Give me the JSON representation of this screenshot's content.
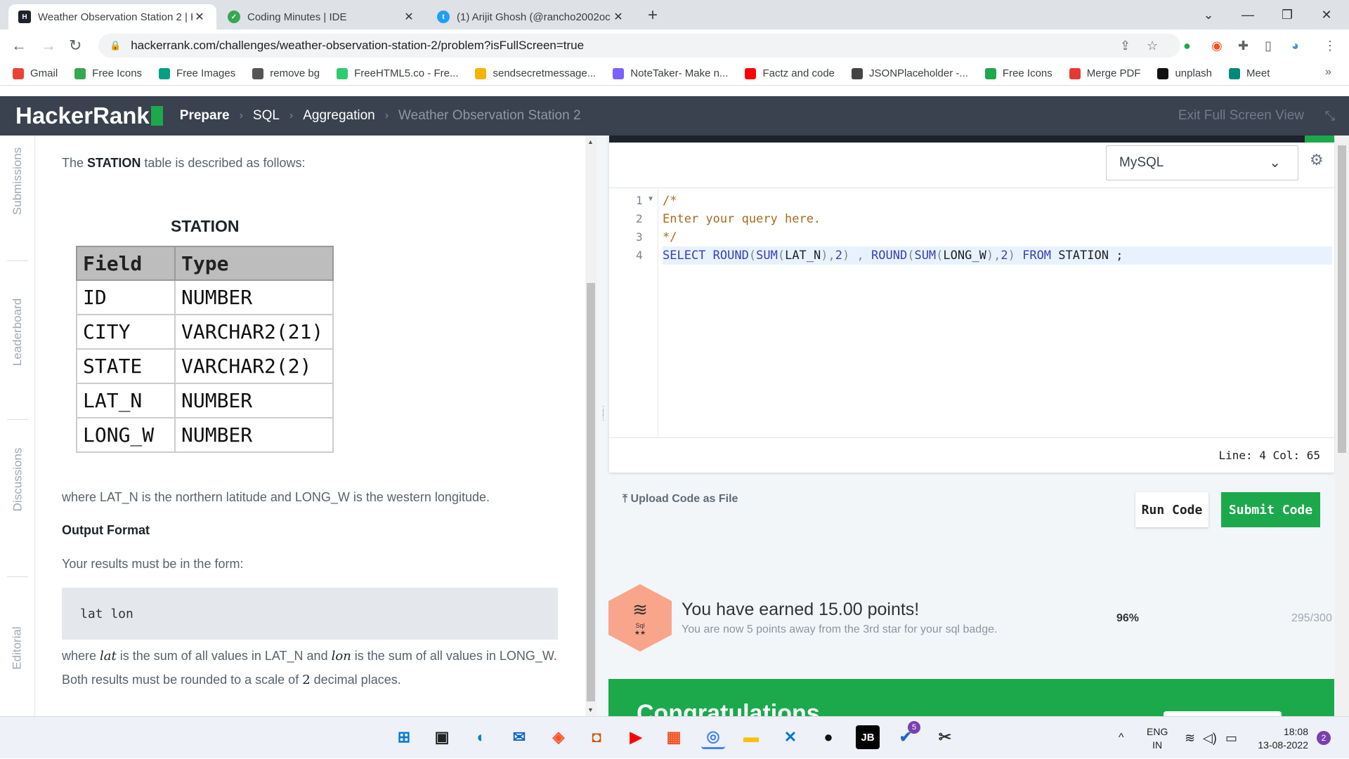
{
  "browser": {
    "tabs": [
      {
        "title": "Weather Observation Station 2 | H",
        "icon": "hackerrank-icon",
        "active": true
      },
      {
        "title": "Coding Minutes | IDE",
        "icon": "check-circle-icon",
        "active": false
      },
      {
        "title": "(1) Arijit Ghosh (@rancho2002oc",
        "icon": "twitter-icon",
        "active": false
      }
    ],
    "url": "hackerrank.com/challenges/weather-observation-station-2/problem?isFullScreen=true",
    "bookmarks": [
      {
        "label": "Gmail",
        "icon": "gmail-icon",
        "color": "#ea4335"
      },
      {
        "label": "Free Icons",
        "icon": "leaf-icon",
        "color": "#34a853"
      },
      {
        "label": "Free Images",
        "icon": "pexels-icon",
        "color": "#05a081"
      },
      {
        "label": "remove bg",
        "icon": "removebg-icon",
        "color": "#555555"
      },
      {
        "label": "FreeHTML5.co - Fre...",
        "icon": "html5-icon",
        "color": "#2ecc71"
      },
      {
        "label": "sendsecretmessage...",
        "icon": "message-icon",
        "color": "#f4b400"
      },
      {
        "label": "NoteTaker- Make n...",
        "icon": "note-icon",
        "color": "#7b61ff"
      },
      {
        "label": "Factz and code",
        "icon": "youtube-icon",
        "color": "#ff0000"
      },
      {
        "label": "JSONPlaceholder -...",
        "icon": "json-icon",
        "color": "#444444"
      },
      {
        "label": "Free Icons",
        "icon": "icons-icon",
        "color": "#1ba94c"
      },
      {
        "label": "Merge PDF",
        "icon": "pdf-icon",
        "color": "#e53935"
      },
      {
        "label": "unplash",
        "icon": "unsplash-icon",
        "color": "#111111"
      },
      {
        "label": "Meet",
        "icon": "meet-icon",
        "color": "#00897b"
      }
    ]
  },
  "header": {
    "logo": "HackerRank",
    "crumbs": [
      "Prepare",
      "SQL",
      "Aggregation",
      "Weather Observation Station 2"
    ],
    "exit_label": "Exit Full Screen View"
  },
  "side_tabs": [
    "Submissions",
    "Leaderboard",
    "Discussions",
    "Editorial"
  ],
  "problem": {
    "intro_pre": "The ",
    "intro_bold": "STATION",
    "intro_post": " table is described as follows:",
    "table_title": "STATION",
    "table_headers": [
      "Field",
      "Type"
    ],
    "table_rows": [
      [
        "ID",
        "NUMBER"
      ],
      [
        "CITY",
        "VARCHAR2(21)"
      ],
      [
        "STATE",
        "VARCHAR2(2)"
      ],
      [
        "LAT_N",
        "NUMBER"
      ],
      [
        "LONG_W",
        "NUMBER"
      ]
    ],
    "where_text": "where LAT_N is the northern latitude and LONG_W is the western longitude.",
    "output_heading": "Output Format",
    "output_text": "Your results must be in the form:",
    "code_example": "lat lon",
    "sum_pre": "where ",
    "sum_lat": "lat",
    "sum_mid": " is the sum of all values in LAT_N and ",
    "sum_lon": "lon",
    "sum_post": " is the sum of all values in LONG_W.",
    "round_pre": "Both results must be rounded to a scale of ",
    "round_num": "2",
    "round_post": " decimal places."
  },
  "editor": {
    "language": "MySQL",
    "line_numbers": [
      "1",
      "2",
      "3",
      "4"
    ],
    "lines": [
      "/*",
      "Enter your query here.",
      "*/",
      "SELECT ROUND(SUM(LAT_N),2) , ROUND(SUM(LONG_W),2) FROM STATION ;"
    ],
    "status": "Line: 4 Col: 65"
  },
  "actions": {
    "upload_label": "Upload Code as File",
    "run_label": "Run Code",
    "submit_label": "Submit Code"
  },
  "result": {
    "badge_label": "Sql",
    "badge_stars": "★★",
    "earned": "You have earned 15.00 points!",
    "subtext": "You are now 5 points away from the 3rd star for your sql badge.",
    "percent": "96%",
    "score": "295/300",
    "congrats": "Congratulations"
  },
  "taskbar": {
    "lang": "ENG",
    "region": "IN",
    "time": "18:08",
    "date": "13-08-2022",
    "notifications": "2",
    "vscode_badge": "5"
  },
  "colors": {
    "hr_green": "#1ba94c",
    "hr_dark": "#39424e"
  }
}
